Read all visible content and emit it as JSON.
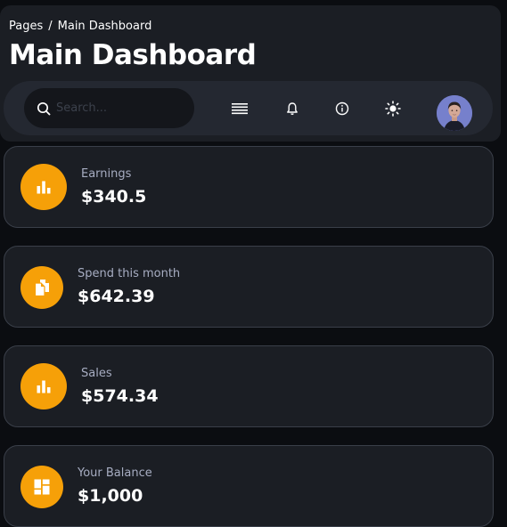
{
  "breadcrumb": {
    "root": "Pages",
    "separator": "/",
    "current": "Main Dashboard"
  },
  "page_title": "Main Dashboard",
  "search": {
    "placeholder": "Search..."
  },
  "navbar": {
    "icons": [
      "menu-icon",
      "bell-icon",
      "info-icon",
      "sun-icon"
    ],
    "avatar": "user-avatar"
  },
  "cards": [
    {
      "label": "Earnings",
      "value": "$340.5",
      "icon": "bar-chart-icon"
    },
    {
      "label": "Spend this month",
      "value": "$642.39",
      "icon": "files-icon"
    },
    {
      "label": "Sales",
      "value": "$574.34",
      "icon": "bar-chart-icon"
    },
    {
      "label": "Your Balance",
      "value": "$1,000",
      "icon": "dashboard-icon"
    }
  ],
  "colors": {
    "accent": "#f6a008",
    "background": "#0b0d11",
    "panel": "#1b1e24",
    "label": "#a7adc2"
  }
}
